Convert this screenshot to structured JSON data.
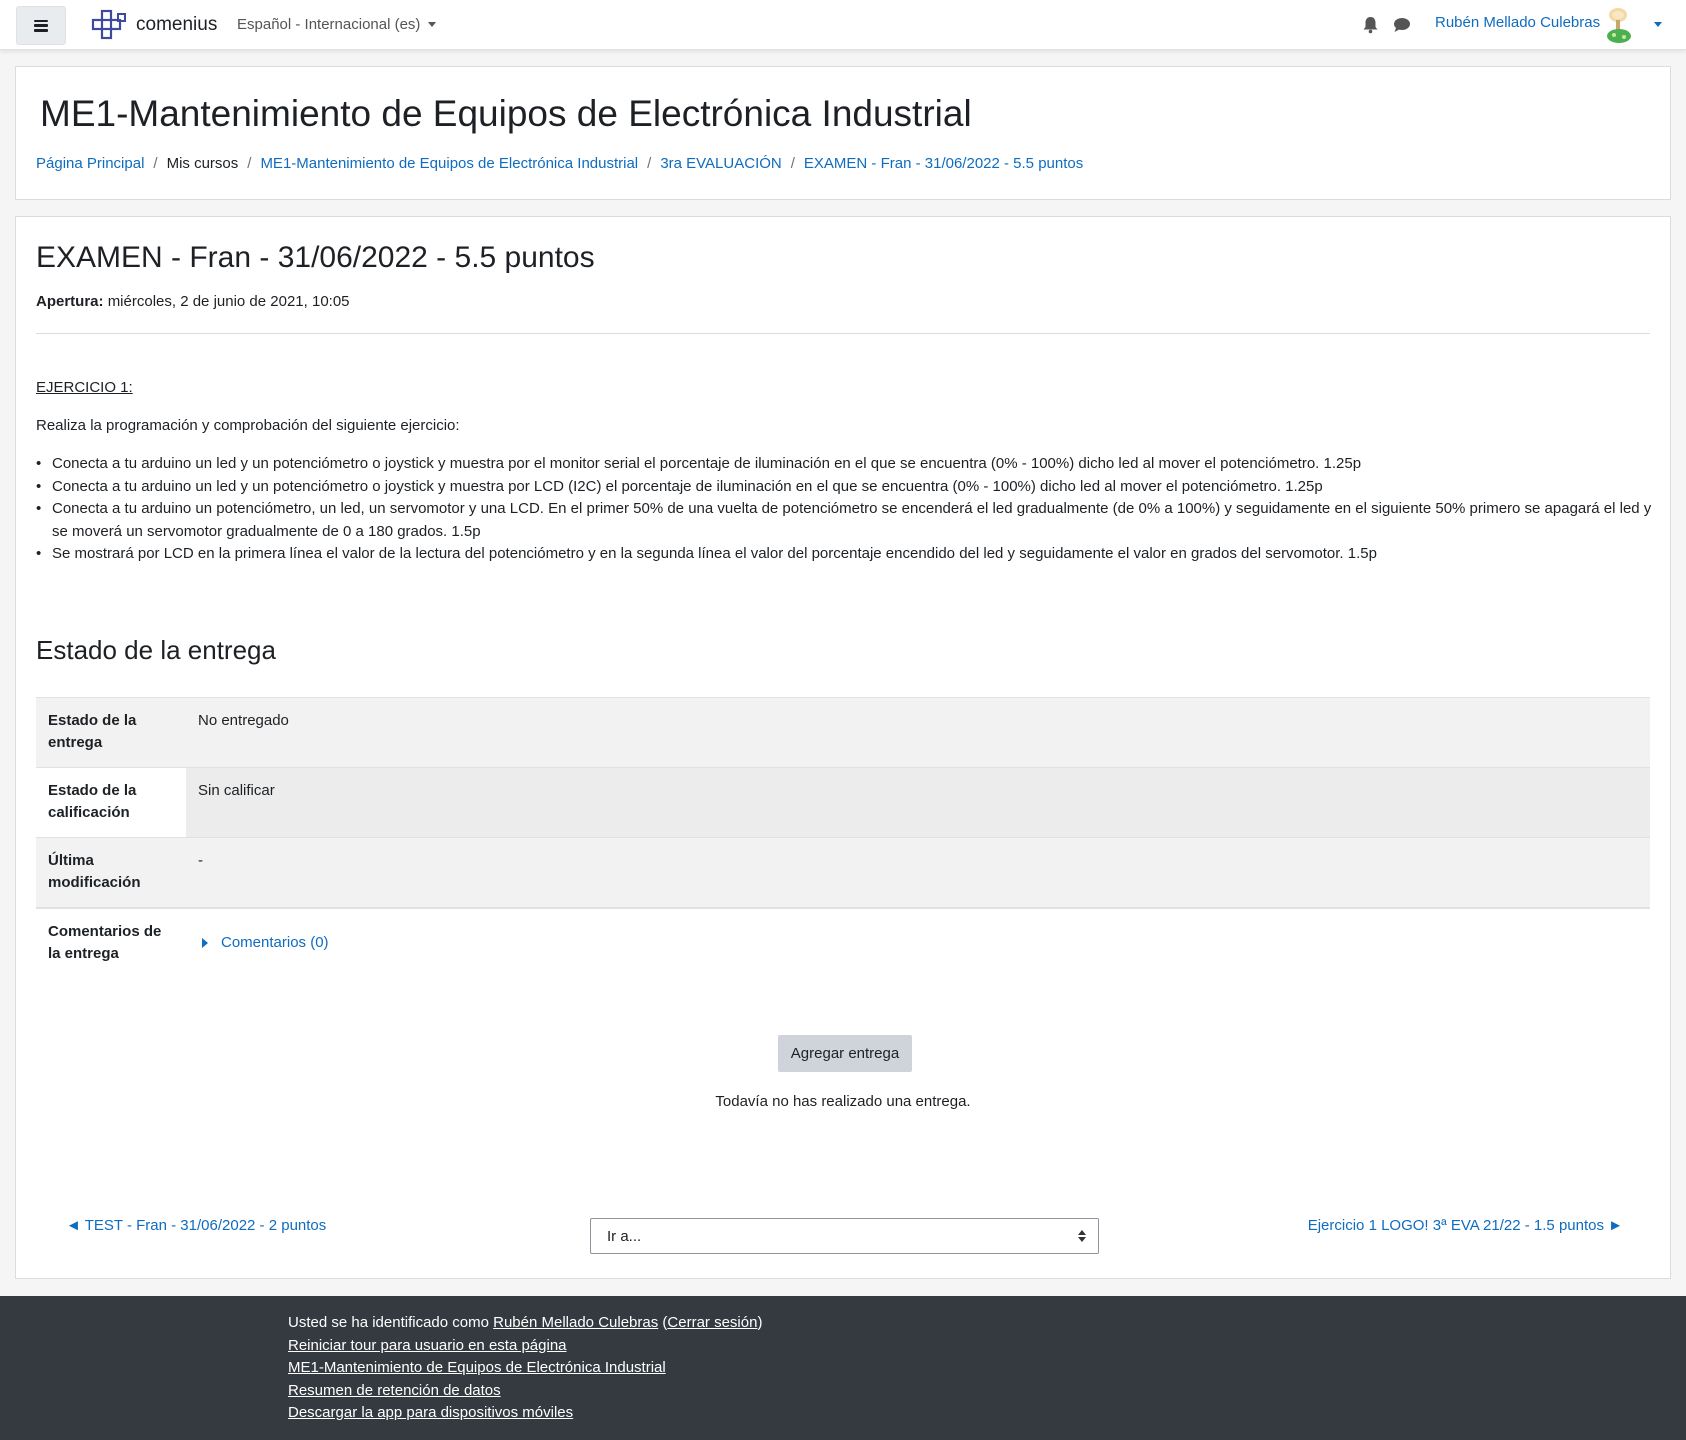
{
  "navbar": {
    "brand": "comenius",
    "language": "Español - Internacional (es)",
    "user_name": "Rubén Mellado Culebras",
    "icons": [
      "menu-icon",
      "bell-icon",
      "chat-icon"
    ]
  },
  "header": {
    "course_title": "ME1-Mantenimiento de Equipos de Electrónica Industrial",
    "breadcrumb": [
      "Página Principal",
      "Mis cursos",
      "ME1-Mantenimiento de Equipos de Electrónica Industrial",
      "3ra EVALUACIÓN",
      "EXAMEN - Fran - 31/06/2022 - 5.5 puntos"
    ]
  },
  "assignment": {
    "title": "EXAMEN - Fran - 31/06/2022 - 5.5 puntos",
    "opening_label": "Apertura:",
    "opening_value": "miércoles, 2 de junio de 2021, 10:05",
    "exercise_title": "EJERCICIO 1:",
    "intro": "Realiza la programación y comprobación del siguiente ejercicio:",
    "bullets": [
      "Conecta a tu arduino un led y un potenciómetro o joystick y muestra por el monitor serial el porcentaje de iluminación en el que se encuentra (0% - 100%) dicho led al mover el potenciómetro. 1.25p",
      "Conecta a tu arduino un led y un potenciómetro o joystick y muestra por LCD (I2C) el porcentaje de iluminación en el que se encuentra (0% - 100%) dicho led al mover el potenciómetro. 1.25p",
      "Conecta  a tu arduino un potenciómetro, un led, un servomotor y una LCD. En el primer 50% de una vuelta de potenciómetro se encenderá el led gradualmente (de 0% a 100%) y seguidamente en el siguiente 50% primero se apagará el led y se moverá un servomotor gradualmente de 0 a 180 grados. 1.5p",
      "Se mostrará por LCD en la primera línea el valor de la lectura del potenciómetro y en la segunda línea el valor del porcentaje encendido del led y seguidamente el valor en grados del servomotor. 1.5p"
    ]
  },
  "status": {
    "heading": "Estado de la entrega",
    "rows": [
      {
        "label": "Estado de la entrega",
        "value": "No entregado"
      },
      {
        "label": "Estado de la calificación",
        "value": "Sin calificar"
      },
      {
        "label": "Última modificación",
        "value": "-"
      },
      {
        "label": "Comentarios de la entrega",
        "value": "Comentarios (0)"
      }
    ],
    "add_button": "Agregar entrega",
    "no_submission": "Todavía no has realizado una entrega."
  },
  "navigation": {
    "prev": "◄ TEST - Fran - 31/06/2022 - 2 puntos",
    "jump_placeholder": "Ir a...",
    "next": "Ejercicio 1 LOGO! 3ª EVA 21/22 - 1.5 puntos ►"
  },
  "footer": {
    "logged_in_prefix": "Usted se ha identificado como ",
    "user_name": "Rubén Mellado Culebras",
    "logout": "Cerrar sesión",
    "links": [
      "Reiniciar tour para usuario en esta página",
      "ME1-Mantenimiento de Equipos de Electrónica Industrial",
      "Resumen de retención de datos",
      "Descargar la app para dispositivos móviles"
    ]
  }
}
